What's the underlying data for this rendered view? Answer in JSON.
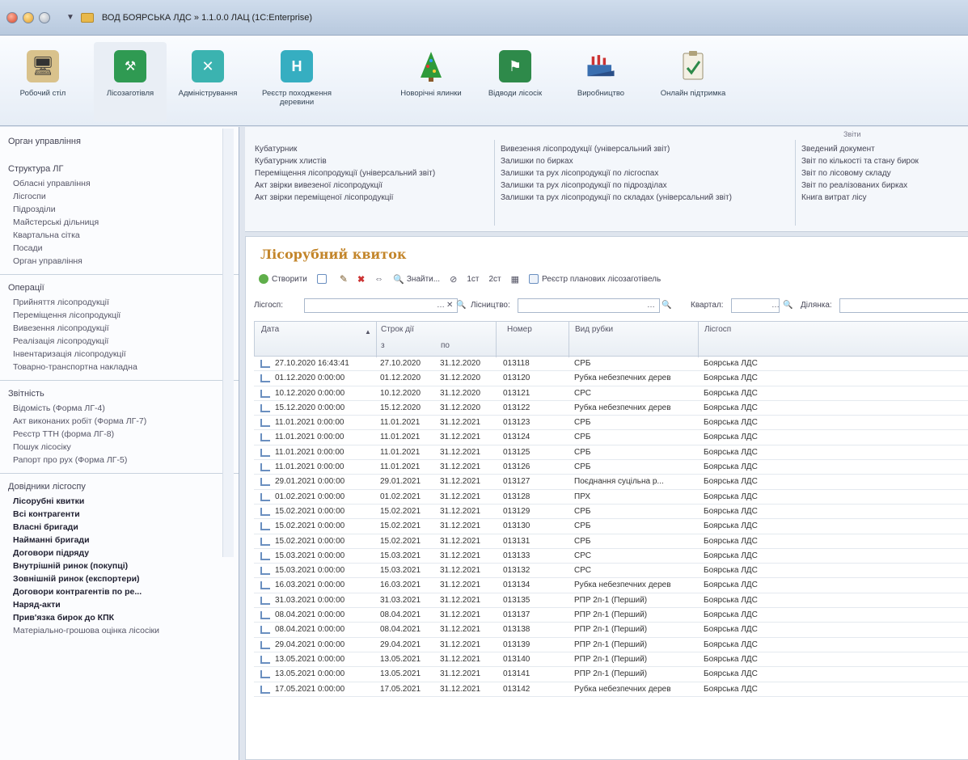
{
  "window": {
    "title": "ВОД БОЯРСЬКА ЛДС » 1.1.0.0 ЛАЦ (1С:Enterprise)"
  },
  "ribbon": [
    {
      "label": "Робочий стіл",
      "icon": "desk-icon"
    },
    {
      "label": "Лісозаготівля",
      "icon": "forest-harvest-icon",
      "active": true
    },
    {
      "label": "Адміністрування",
      "icon": "tools-icon"
    },
    {
      "label": "Реєстр походження деревини",
      "icon": "register-icon"
    },
    {
      "label": "Новорічні ялинки",
      "icon": "christmas-tree-icon"
    },
    {
      "label": "Відводи лісосік",
      "icon": "flag-icon"
    },
    {
      "label": "Виробництво",
      "icon": "factory-icon"
    },
    {
      "label": "Онлайн підтримка",
      "icon": "clipboard-icon"
    }
  ],
  "sidebar": {
    "sections": [
      {
        "title": "Орган управління",
        "items": []
      },
      {
        "title": "Структура ЛГ",
        "items": [
          "Обласні управління",
          "Лісгоспи",
          "Підрозділи",
          "Майстерські дільниця",
          "Квартальна сітка",
          "Посади",
          "Орган управління"
        ]
      },
      {
        "title": "Операції",
        "items": [
          "Прийняття лісопродукції",
          "Переміщення лісопродукції",
          "Вивезення лісопродукції",
          "Реалізація лісопродукції",
          "Інвентаризація лісопродукції",
          "Товарно-транспортна накладна"
        ]
      },
      {
        "title": "Звітність",
        "items": [
          "Відомість (Форма ЛГ-4)",
          "Акт виконаних робіт (Форма ЛГ-7)",
          "Реєстр ТТН (форма ЛГ-8)",
          "Пошук лісосіку",
          "Рапорт про рух (Форма ЛГ-5)"
        ]
      },
      {
        "title": "Довідники лісгоспу",
        "items": [
          "Лісорубні квитки",
          "Всі контрагенти",
          "Власні бригади",
          "Найманні бригади",
          "Договори підряду",
          "Внутрішній ринок (покупці)",
          "Зовнішній ринок (експортери)",
          "Договори контрагентів по ре...",
          "Наряд-акти",
          "Прив'язка бирок до КПК",
          "Матеріально-грошова оцінка лісосіки"
        ],
        "bold_from": 0
      }
    ]
  },
  "functions": {
    "header": "Звіти",
    "columns": [
      [
        "Кубатурник",
        "Кубатурник хлистів",
        "Переміщення лісопродукції (універсальний звіт)",
        "Акт звірки вивезеної лісопродукції",
        "Акт звірки переміщеної лісопродукції"
      ],
      [
        "Вивезення лісопродукції (універсальний звіт)",
        "Залишки по бирках",
        "Залишки та рух лісопродукції по лісгоспах",
        "Залишки та рух лісопродукції по підрозділах",
        "Залишки та рух лісопродукції по складах (універсальний звіт)"
      ],
      [
        "Зведений документ",
        "Звіт по кількості та стану бирок",
        "Звіт по лісовому складу",
        "Звіт по реалізованих бирках",
        "Книга витрат лісу"
      ]
    ]
  },
  "form": {
    "title": "Лісорубний квиток",
    "commands": [
      "Створити",
      "Знайти...",
      "1ст",
      "2ст",
      "Реєстр планових лісозаготівель"
    ],
    "filters": {
      "forestry_label": "Лісгосп:",
      "forestry_value": "",
      "lisnytstvo_label": "Лісництво:",
      "lisnytstvo_value": "",
      "quarter_label": "Квартал:",
      "quarter_value": "",
      "plot_label": "Ділянка:",
      "plot_value": ""
    },
    "table": {
      "headers": {
        "date": "Дата",
        "term": "Строк дії",
        "from": "з",
        "to": "по",
        "number": "Номер",
        "type": "Вид рубки",
        "forestry": "Лісгосп"
      },
      "rows": [
        [
          "27.10.2020 16:43:41",
          "27.10.2020",
          "31.12.2020",
          "013118",
          "СРБ",
          "Боярська ЛДС"
        ],
        [
          "01.12.2020 0:00:00",
          "01.12.2020",
          "31.12.2020",
          "013120",
          "Рубка небезпечних дерев",
          "Боярська ЛДС"
        ],
        [
          "10.12.2020 0:00:00",
          "10.12.2020",
          "31.12.2020",
          "013121",
          "СРС",
          "Боярська ЛДС"
        ],
        [
          "15.12.2020 0:00:00",
          "15.12.2020",
          "31.12.2020",
          "013122",
          "Рубка небезпечних дерев",
          "Боярська ЛДС"
        ],
        [
          "11.01.2021 0:00:00",
          "11.01.2021",
          "31.12.2021",
          "013123",
          "СРБ",
          "Боярська ЛДС"
        ],
        [
          "11.01.2021 0:00:00",
          "11.01.2021",
          "31.12.2021",
          "013124",
          "СРБ",
          "Боярська ЛДС"
        ],
        [
          "11.01.2021 0:00:00",
          "11.01.2021",
          "31.12.2021",
          "013125",
          "СРБ",
          "Боярська ЛДС"
        ],
        [
          "11.01.2021 0:00:00",
          "11.01.2021",
          "31.12.2021",
          "013126",
          "СРБ",
          "Боярська ЛДС"
        ],
        [
          "29.01.2021 0:00:00",
          "29.01.2021",
          "31.12.2021",
          "013127",
          "Поєднання суцільна р...",
          "Боярська ЛДС"
        ],
        [
          "01.02.2021 0:00:00",
          "01.02.2021",
          "31.12.2021",
          "013128",
          "ПРХ",
          "Боярська ЛДС"
        ],
        [
          "15.02.2021 0:00:00",
          "15.02.2021",
          "31.12.2021",
          "013129",
          "СРБ",
          "Боярська ЛДС"
        ],
        [
          "15.02.2021 0:00:00",
          "15.02.2021",
          "31.12.2021",
          "013130",
          "СРБ",
          "Боярська ЛДС"
        ],
        [
          "15.02.2021 0:00:00",
          "15.02.2021",
          "31.12.2021",
          "013131",
          "СРБ",
          "Боярська ЛДС"
        ],
        [
          "15.03.2021 0:00:00",
          "15.03.2021",
          "31.12.2021",
          "013133",
          "СРС",
          "Боярська ЛДС"
        ],
        [
          "15.03.2021 0:00:00",
          "15.03.2021",
          "31.12.2021",
          "013132",
          "СРС",
          "Боярська ЛДС"
        ],
        [
          "16.03.2021 0:00:00",
          "16.03.2021",
          "31.12.2021",
          "013134",
          "Рубка небезпечних дерев",
          "Боярська ЛДС"
        ],
        [
          "31.03.2021 0:00:00",
          "31.03.2021",
          "31.12.2021",
          "013135",
          "РПР 2п-1 (Перший)",
          "Боярська ЛДС"
        ],
        [
          "08.04.2021 0:00:00",
          "08.04.2021",
          "31.12.2021",
          "013137",
          "РПР 2п-1 (Перший)",
          "Боярська ЛДС"
        ],
        [
          "08.04.2021 0:00:00",
          "08.04.2021",
          "31.12.2021",
          "013138",
          "РПР 2п-1 (Перший)",
          "Боярська ЛДС"
        ],
        [
          "29.04.2021 0:00:00",
          "29.04.2021",
          "31.12.2021",
          "013139",
          "РПР 2п-1 (Перший)",
          "Боярська ЛДС"
        ],
        [
          "13.05.2021 0:00:00",
          "13.05.2021",
          "31.12.2021",
          "013140",
          "РПР 2п-1 (Перший)",
          "Боярська ЛДС"
        ],
        [
          "13.05.2021 0:00:00",
          "13.05.2021",
          "31.12.2021",
          "013141",
          "РПР 2п-1 (Перший)",
          "Боярська ЛДС"
        ],
        [
          "17.05.2021 0:00:00",
          "17.05.2021",
          "31.12.2021",
          "013142",
          "Рубка небезпечних дерев",
          "Боярська ЛДС"
        ]
      ]
    }
  }
}
